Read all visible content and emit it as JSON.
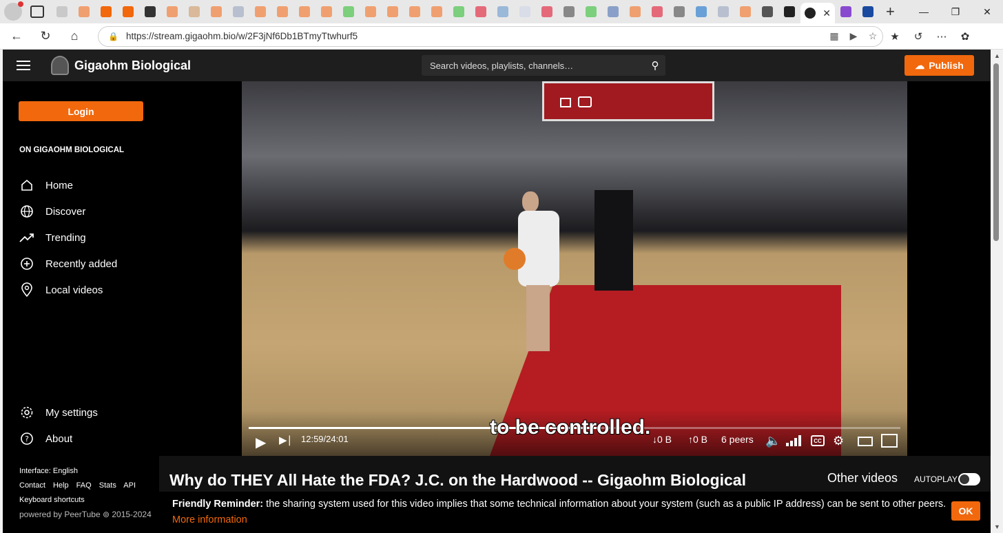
{
  "browser": {
    "url": "https://stream.gigaohm.bio/w/2F3jNf6Db1BTmyTtwhurf5",
    "active_tab_close": "✕",
    "new_tab": "+"
  },
  "header": {
    "brand": "Gigaohm Biological",
    "search_placeholder": "Search videos, playlists, channels…",
    "publish_label": "Publish"
  },
  "sidebar": {
    "login_label": "Login",
    "section_title": "ON GIGAOHM BIOLOGICAL",
    "items": [
      {
        "label": "Home",
        "icon": "home-icon"
      },
      {
        "label": "Discover",
        "icon": "globe-icon"
      },
      {
        "label": "Trending",
        "icon": "trending-icon"
      },
      {
        "label": "Recently added",
        "icon": "plus-circle-icon"
      },
      {
        "label": "Local videos",
        "icon": "location-icon"
      }
    ],
    "settings_label": "My settings",
    "about_label": "About",
    "interface": "Interface: English",
    "links": [
      "Contact",
      "Help",
      "FAQ",
      "Stats",
      "API"
    ],
    "shortcuts": "Keyboard shortcuts",
    "powered": "powered by PeerTube ⊚ 2015-2024"
  },
  "player": {
    "subtitle": "to be controlled.",
    "time": "12:59/24:01",
    "progress": 0.54,
    "down": "0 B",
    "up": "0 B",
    "peers": "6 peers",
    "cc": "CC"
  },
  "video_info": {
    "title": "Why do THEY All Hate the FDA? J.C. on the Hardwood -- Gigaohm Biological",
    "other_videos": "Other videos",
    "autoplay": "AUTOPLAY"
  },
  "reminder": {
    "bold": "Friendly Reminder:",
    "text": " the sharing system used for this video implies that some technical information about your system (such as a public IP address) can be sent to other peers.",
    "more": "More information",
    "ok": "OK"
  },
  "colors": {
    "accent": "#f1680d",
    "header": "#1e1e1e"
  }
}
